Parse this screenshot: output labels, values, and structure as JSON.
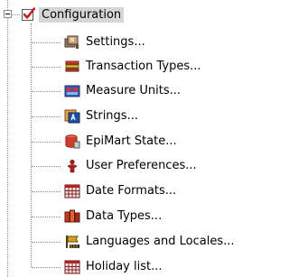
{
  "root": {
    "label": "Configuration",
    "icon": "checked-checkbox-icon",
    "expanded": true,
    "selected": true
  },
  "children": [
    {
      "label": "Settings...",
      "icon": "settings-icon"
    },
    {
      "label": "Transaction Types...",
      "icon": "stacked-cards-icon"
    },
    {
      "label": "Measure Units...",
      "icon": "measure-units-icon"
    },
    {
      "label": "Strings...",
      "icon": "strings-icon"
    },
    {
      "label": "EpiMart State...",
      "icon": "database-state-icon"
    },
    {
      "label": "User Preferences...",
      "icon": "user-icon"
    },
    {
      "label": "Date Formats...",
      "icon": "calendar-grid-icon"
    },
    {
      "label": "Data Types...",
      "icon": "data-types-icon"
    },
    {
      "label": "Languages and Locales...",
      "icon": "locale-flag-icon"
    },
    {
      "label": "Holiday list...",
      "icon": "calendar-grid-icon"
    }
  ],
  "colors": {
    "selection": "#d6d6d6",
    "tree_lines": "#8f8f8f"
  }
}
